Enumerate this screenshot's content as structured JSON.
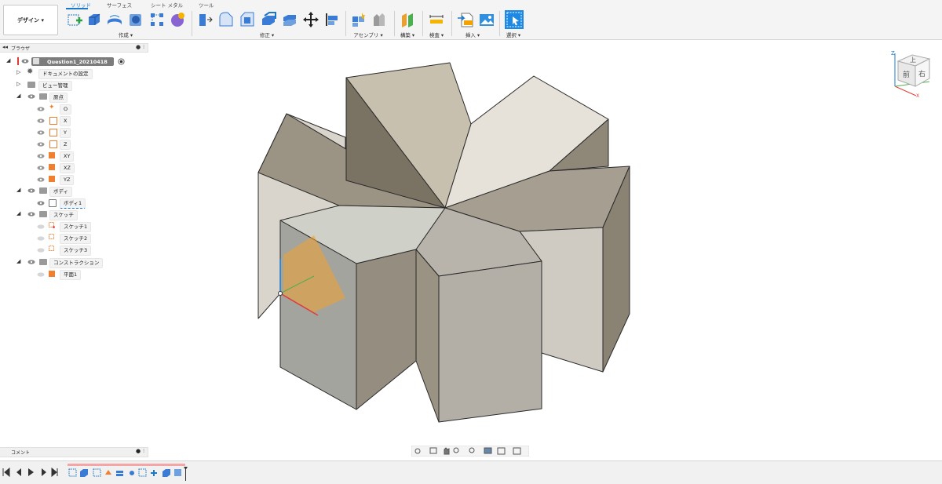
{
  "toolbar": {
    "workspace_button": "デザイン ▾",
    "tabs": [
      "ソリッド",
      "サーフェス",
      "シート メタル",
      "ツール"
    ],
    "groups": {
      "create": "作成 ▾",
      "modify": "修正 ▾",
      "assemble": "アセンブリ ▾",
      "construct": "構築 ▾",
      "inspect": "検査 ▾",
      "insert": "挿入 ▾",
      "select": "選択 ▾"
    }
  },
  "browser": {
    "title": "ブラウザ",
    "root": "Question1_20210418 v5",
    "items": {
      "doc_settings": "ドキュメントの設定",
      "named_views": "ビュー管理",
      "origin": "原点",
      "origin_o": "O",
      "origin_x": "X",
      "origin_y": "Y",
      "origin_z": "Z",
      "plane_xy": "XY",
      "plane_xz": "XZ",
      "plane_yz": "YZ",
      "bodies": "ボディ",
      "body1": "ボディ1",
      "sketches": "スケッチ",
      "sketch1": "スケッチ1",
      "sketch2": "スケッチ2",
      "sketch3": "スケッチ3",
      "construction": "コンストラクション",
      "plane1": "平面1"
    }
  },
  "comments": {
    "title": "コメント"
  },
  "viewcube": {
    "top": "上",
    "front": "前",
    "right": "右",
    "axis_z": "Z",
    "axis_x": "X"
  },
  "colors": {
    "accent": "#1b78c9",
    "model_face_light": "#d8d3c8",
    "model_face_dark": "#9a9181",
    "plane_orange": "#f0a030"
  }
}
